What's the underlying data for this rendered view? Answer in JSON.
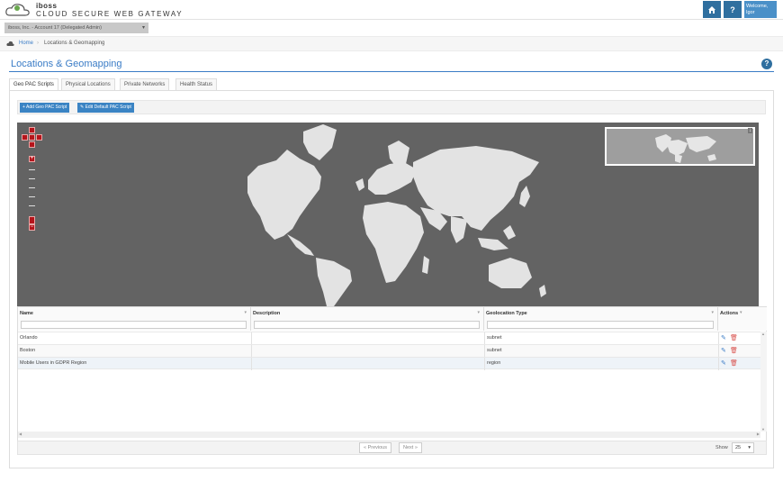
{
  "header": {
    "brand_small": "iboss",
    "brand_big": "CLOUD SECURE WEB GATEWAY",
    "welcome": "Welcome,",
    "user": "Igor",
    "home_icon": "home-icon",
    "help_icon": "help-icon"
  },
  "account": {
    "label": "iboss, Inc. - Account 17 (Delegated Admin)"
  },
  "breadcrumb": {
    "home": "Home",
    "sep": "›",
    "current": "Locations & Geomapping"
  },
  "page": {
    "title": "Locations & Geomapping",
    "help": "?"
  },
  "tabs": [
    {
      "label": "Geo PAC Scripts",
      "active": true
    },
    {
      "label": "Physical Locations"
    },
    {
      "label": "Private Networks"
    },
    {
      "label": "Health Status"
    }
  ],
  "toolbar": {
    "add": "+ Add Geo PAC Script",
    "edit": "✎ Edit Default PAC Script"
  },
  "map": {
    "zoom_in": "+",
    "zoom_out": "−",
    "minimap_toggle": "↓"
  },
  "grid": {
    "columns": [
      "Name",
      "Description",
      "Geolocation Type",
      "Actions"
    ],
    "rows": [
      {
        "name": "Orlando",
        "description": "",
        "type": "subnet"
      },
      {
        "name": "Boston",
        "description": "",
        "type": "subnet"
      },
      {
        "name": "Mobile Users in GDPR Region",
        "description": "",
        "type": "region"
      }
    ]
  },
  "pagination": {
    "prev": "« Previous",
    "next": "Next »",
    "show_label": "Show",
    "page_size": "25"
  },
  "colors": {
    "accent": "#3a7cc6",
    "header_btn": "#2f6f9f",
    "map_bg": "#636363",
    "map_land": "#e3e3e3"
  }
}
